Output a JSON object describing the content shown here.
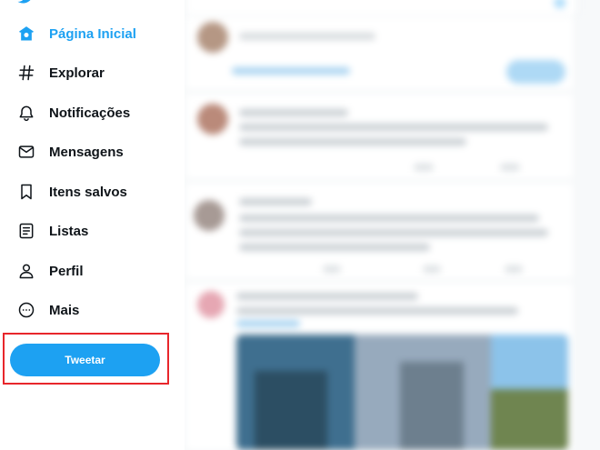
{
  "sidebar": {
    "items": [
      {
        "label": "Página Inicial",
        "icon": "home-icon",
        "active": true
      },
      {
        "label": "Explorar",
        "icon": "hashtag-icon",
        "active": false
      },
      {
        "label": "Notificações",
        "icon": "bell-icon",
        "active": false
      },
      {
        "label": "Mensagens",
        "icon": "envelope-icon",
        "active": false
      },
      {
        "label": "Itens salvos",
        "icon": "bookmark-icon",
        "active": false
      },
      {
        "label": "Listas",
        "icon": "list-icon",
        "active": false
      },
      {
        "label": "Perfil",
        "icon": "person-icon",
        "active": false
      },
      {
        "label": "Mais",
        "icon": "more-circle-icon",
        "active": false
      }
    ],
    "tweet_button_label": "Tweetar"
  },
  "colors": {
    "accent": "#1da1f2",
    "text": "#0f1419",
    "highlight": "#e8262b",
    "feed_background": "#f7f9fa"
  }
}
